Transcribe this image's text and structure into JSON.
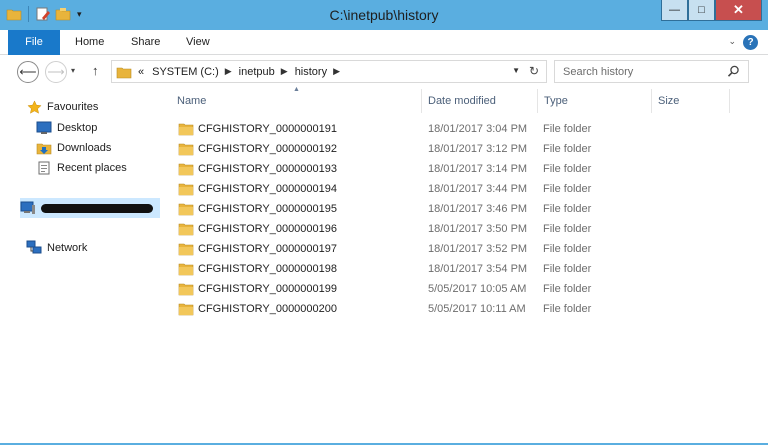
{
  "window": {
    "title": "C:\\inetpub\\history",
    "minimize": "—",
    "maximize": "□",
    "close": "✕"
  },
  "ribbon": {
    "tabs": [
      "File",
      "Home",
      "Share",
      "View"
    ],
    "help": "?"
  },
  "nav": {
    "back": "⟵",
    "forward": "⟶",
    "recent": "▾",
    "up": "↑"
  },
  "address": {
    "overflow": "«",
    "crumbs": [
      "SYSTEM (C:)",
      "inetpub",
      "history"
    ]
  },
  "search": {
    "placeholder": "Search history"
  },
  "navpane": {
    "favourites": "Favourites",
    "items": [
      "Desktop",
      "Downloads",
      "Recent places"
    ],
    "network": "Network"
  },
  "columns": {
    "name": "Name",
    "date": "Date modified",
    "type": "Type",
    "size": "Size"
  },
  "files": [
    {
      "name": "CFGHISTORY_0000000191",
      "date": "18/01/2017 3:04 PM",
      "type": "File folder"
    },
    {
      "name": "CFGHISTORY_0000000192",
      "date": "18/01/2017 3:12 PM",
      "type": "File folder"
    },
    {
      "name": "CFGHISTORY_0000000193",
      "date": "18/01/2017 3:14 PM",
      "type": "File folder"
    },
    {
      "name": "CFGHISTORY_0000000194",
      "date": "18/01/2017 3:44 PM",
      "type": "File folder"
    },
    {
      "name": "CFGHISTORY_0000000195",
      "date": "18/01/2017 3:46 PM",
      "type": "File folder"
    },
    {
      "name": "CFGHISTORY_0000000196",
      "date": "18/01/2017 3:50 PM",
      "type": "File folder"
    },
    {
      "name": "CFGHISTORY_0000000197",
      "date": "18/01/2017 3:52 PM",
      "type": "File folder"
    },
    {
      "name": "CFGHISTORY_0000000198",
      "date": "18/01/2017 3:54 PM",
      "type": "File folder"
    },
    {
      "name": "CFGHISTORY_0000000199",
      "date": "5/05/2017 10:05 AM",
      "type": "File folder"
    },
    {
      "name": "CFGHISTORY_0000000200",
      "date": "5/05/2017 10:11 AM",
      "type": "File folder"
    }
  ],
  "colors": {
    "titlebar": "#5aaee0",
    "file_tab": "#1979ca",
    "selection": "#cce8ff",
    "folder": "#e8b43c",
    "close_button": "#c74f4f"
  }
}
